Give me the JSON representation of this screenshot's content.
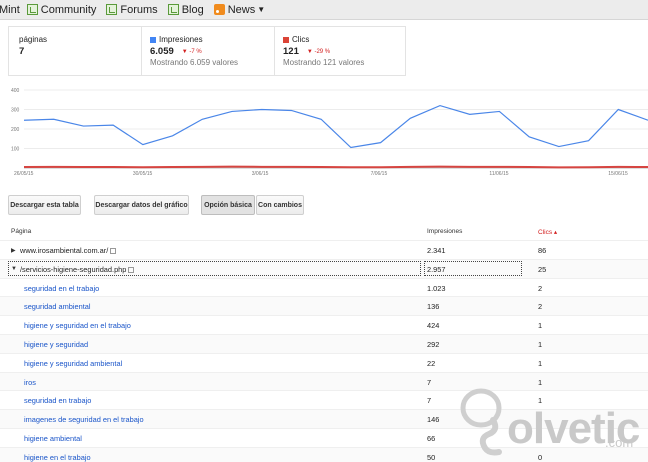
{
  "bookmarks": [
    {
      "label": "Mint",
      "icon": "none"
    },
    {
      "label": "Community",
      "icon": "bookmark-icon"
    },
    {
      "label": "Forums",
      "icon": "bookmark-icon"
    },
    {
      "label": "Blog",
      "icon": "bookmark-icon"
    },
    {
      "label": "News",
      "icon": "rss-icon"
    }
  ],
  "summary": {
    "paginas": {
      "label": "páginas",
      "value": "7"
    },
    "impresiones": {
      "label": "Impresiones",
      "value": "6.059",
      "change": "-7 %",
      "sub": "Mostrando 6.059 valores",
      "color": "#4285f4"
    },
    "clics": {
      "label": "Clics",
      "value": "121",
      "change": "-29 %",
      "sub": "Mostrando 121 valores",
      "color": "#db4437"
    }
  },
  "chart_data": {
    "type": "line",
    "y_ticks": [
      "400",
      "300",
      "200",
      "100",
      ""
    ],
    "ylim": [
      0,
      400
    ],
    "x_ticks": [
      "26/05/15",
      "30/05/15",
      "3/06/15",
      "7/06/15",
      "11/06/15",
      "15/06/15"
    ],
    "series": [
      {
        "name": "Impresiones",
        "color": "#4a86e8",
        "values": [
          245,
          250,
          215,
          220,
          120,
          165,
          250,
          290,
          300,
          295,
          250,
          105,
          130,
          255,
          320,
          275,
          290,
          160,
          110,
          140,
          300,
          245
        ]
      },
      {
        "name": "Clics",
        "color": "#d64541",
        "values": [
          5,
          6,
          5,
          5,
          4,
          5,
          6,
          7,
          6,
          6,
          5,
          4,
          4,
          6,
          7,
          6,
          6,
          5,
          3,
          4,
          6,
          5
        ]
      }
    ]
  },
  "buttons": {
    "download_table": "Descargar esta tabla",
    "download_chart": "Descargar datos del gráfico",
    "basic_option": "Opción básica",
    "with_changes": "Con cambios"
  },
  "table": {
    "headers": {
      "page": "Página",
      "impressions": "Impresiones",
      "clicks": "Clics ▴"
    },
    "rows": [
      {
        "page": "www.irosambiental.com.ar/",
        "impressions": "2.341",
        "clicks": "86",
        "kind": "parent",
        "expanded": false
      },
      {
        "page": "/servicios-higiene-seguridad.php",
        "impressions": "2.957",
        "clicks": "25",
        "kind": "parent",
        "expanded": true
      },
      {
        "page": "seguridad en el trabajo",
        "impressions": "1.023",
        "clicks": "2"
      },
      {
        "page": "seguridad ambiental",
        "impressions": "136",
        "clicks": "2"
      },
      {
        "page": "higiene y seguridad en el trabajo",
        "impressions": "424",
        "clicks": "1"
      },
      {
        "page": "higiene y seguridad",
        "impressions": "292",
        "clicks": "1"
      },
      {
        "page": "higiene y seguridad ambiental",
        "impressions": "22",
        "clicks": "1"
      },
      {
        "page": "iros",
        "impressions": "7",
        "clicks": "1"
      },
      {
        "page": "seguridad en trabajo",
        "impressions": "7",
        "clicks": "1"
      },
      {
        "page": "imagenes de seguridad en el trabajo",
        "impressions": "146",
        "clicks": "0"
      },
      {
        "page": "higiene ambiental",
        "impressions": "66",
        "clicks": "0"
      },
      {
        "page": "higiene en el trabajo",
        "impressions": "50",
        "clicks": "0"
      }
    ]
  },
  "watermark": {
    "brand": "olvetic",
    "suffix": ".com"
  }
}
